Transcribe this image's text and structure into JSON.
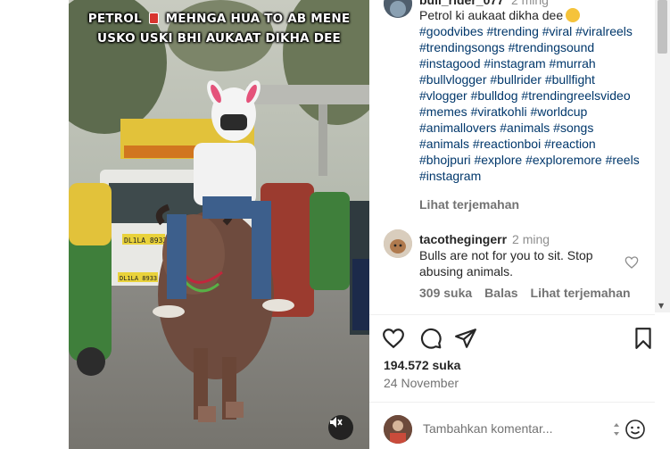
{
  "video": {
    "overlay_line1": "PETROL",
    "overlay_line1b": "MEHNGA HUA TO AB MENE",
    "overlay_line2": "USKO USKI BHI AUKAAT DIKHA DEE",
    "plate_1": "DL1LA 8933",
    "plate_2": "DL1LA 8933"
  },
  "post": {
    "author": "bull_rider_077",
    "author_time": "2 ming",
    "caption_text": "Petrol ki aukaat dikha dee",
    "hashtags": "#goodvibes #trending #viral #viralreels #trendingsongs #trendingsound #instagood #instagram #murrah #bullvlogger #bullrider #bullfight #vlogger #bulldog #trendingreelsvideo #memes #viratkohli #worldcup #animallovers #animals #songs #animals #reactionboi #reaction #bhojpuri #explore #exploremore #reels #instagram",
    "translate_label": "Lihat terjemahan"
  },
  "comment": {
    "username": "tacothegingerr",
    "time": "2 ming",
    "text": "Bulls are not for you to sit. Stop abusing animals.",
    "likes": "309 suka",
    "reply": "Balas",
    "translate": "Lihat terjemahan"
  },
  "stats": {
    "likes": "194.572 suka",
    "date": "24 November"
  },
  "composer": {
    "placeholder": "Tambahkan komentar..."
  },
  "icons": {
    "like": "heart-icon",
    "comment": "comment-icon",
    "share": "share-icon",
    "save": "bookmark-icon",
    "mute": "speaker-muted-icon",
    "emoji": "emoji-icon"
  }
}
